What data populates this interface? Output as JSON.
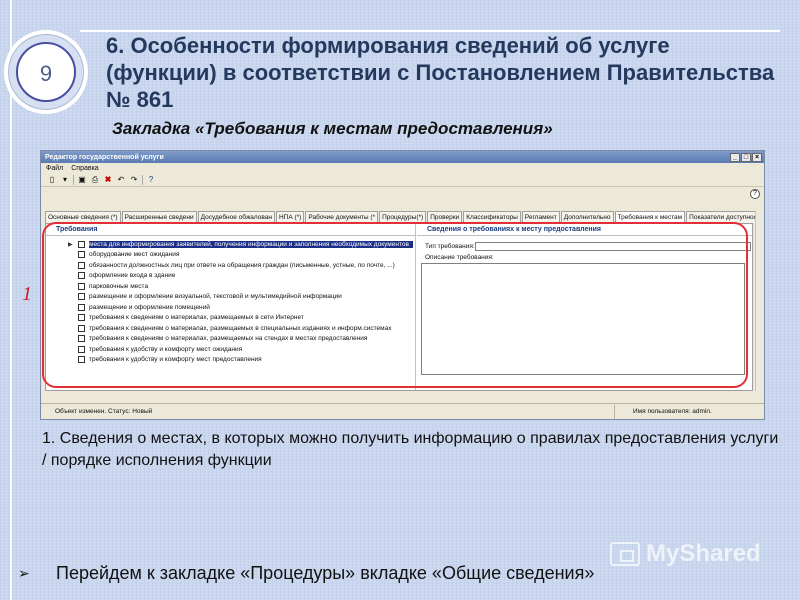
{
  "slide": {
    "number": "9",
    "title": "6. Особенности формирования сведений об услуге (функции) в соответствии с Постановлением Правительства № 861",
    "subtitle": "Закладка «Требования к местам предоставления»",
    "annotation_number": "1",
    "caption": "1. Сведения о местах, в которых можно получить информацию о правилах предоставления услуги / порядке исполнения функции",
    "footer_text": "Перейдем к закладке «Процедуры» вкладке «Общие сведения»",
    "watermark": "MyShared"
  },
  "app": {
    "title": "Редактор государственной услуги",
    "window_buttons": [
      "_",
      "□",
      "×"
    ],
    "menu": [
      "Файл",
      "Справка"
    ],
    "toolbar_icons": [
      "new-icon",
      "open-icon",
      "save-icon",
      "print-icon",
      "delete-icon",
      "undo-icon",
      "redo-icon",
      "help-icon"
    ],
    "help_button": "?",
    "tabs": [
      "Основные сведения (*)",
      "Расширенные сведени",
      "Досудебное обжалован",
      "НПА (*)",
      "Рабочие документы (*",
      "Процедуры(*)",
      "Проверки",
      "Классификаторы",
      "Регламент",
      "Дополнительно",
      "Требования к местам",
      "Показатели доступнос"
    ],
    "requirements_header": "Требования",
    "requirements": [
      "места для информирования заявителей, получения информации и заполнения необходимых документов",
      "оборудование мест ожидания",
      "обязанности должностных лиц при ответе на обращения граждан (письменные, устные, по почте, ...)",
      "оформление входа в здание",
      "парковочные места",
      "размещение и оформление визуальной, текстовой и мультимедийной информации",
      "размещение и оформление помещений",
      "требования к сведениям о материалах, размещаемых в сети Интернет",
      "требования к сведениям о материалах, размещаемых в специальных изданиях и информ.системах",
      "требования к сведениям о материалах, размещаемых на стендах в местах предоставления",
      "требования к удобству и комфорту мест ожидания",
      "требования к удобству и комфорту мест предоставления"
    ],
    "details_header": "Сведения о требованиях к месту предоставления",
    "type_label": "Тип требования:",
    "description_label": "Описание требования:",
    "status_left": "Объект изменен. Статус: Новый",
    "status_right": "Имя пользователя: admin."
  }
}
